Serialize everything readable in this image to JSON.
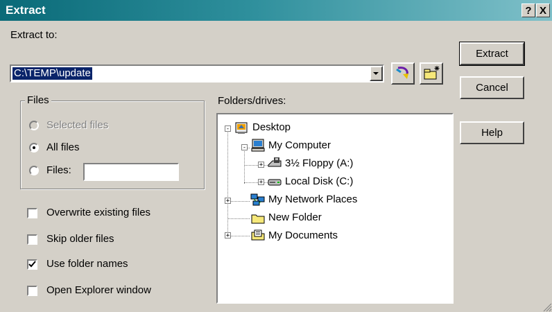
{
  "window": {
    "title": "Extract",
    "help_button": "?",
    "close_button": "X"
  },
  "extract_to": {
    "label": "Extract to:",
    "value": "C:\\TEMP\\update"
  },
  "buttons": {
    "extract": "Extract",
    "cancel": "Cancel",
    "help": "Help"
  },
  "files_group": {
    "title": "Files",
    "options": [
      {
        "label": "Selected files",
        "selected": false,
        "enabled": false
      },
      {
        "label": "All files",
        "selected": true,
        "enabled": true
      },
      {
        "label": "Files:",
        "selected": false,
        "enabled": true
      }
    ],
    "files_pattern_value": ""
  },
  "checkboxes": [
    {
      "label": "Overwrite existing files",
      "checked": false
    },
    {
      "label": "Skip older files",
      "checked": false
    },
    {
      "label": "Use folder names",
      "checked": true
    },
    {
      "label": "Open Explorer window",
      "checked": false
    }
  ],
  "folders": {
    "label": "Folders/drives:",
    "tree": [
      {
        "label": "Desktop",
        "icon": "desktop-icon",
        "expander": "-"
      },
      {
        "label": "My Computer",
        "icon": "computer-icon",
        "expander": "-"
      },
      {
        "label": "3½ Floppy (A:)",
        "icon": "floppy-drive-icon",
        "expander": "+"
      },
      {
        "label": "Local Disk (C:)",
        "icon": "hard-drive-icon",
        "expander": "+"
      },
      {
        "label": "My Network Places",
        "icon": "network-places-icon",
        "expander": "+"
      },
      {
        "label": "New Folder",
        "icon": "folder-icon",
        "expander": ""
      },
      {
        "label": "My Documents",
        "icon": "my-documents-icon",
        "expander": "+"
      }
    ]
  }
}
